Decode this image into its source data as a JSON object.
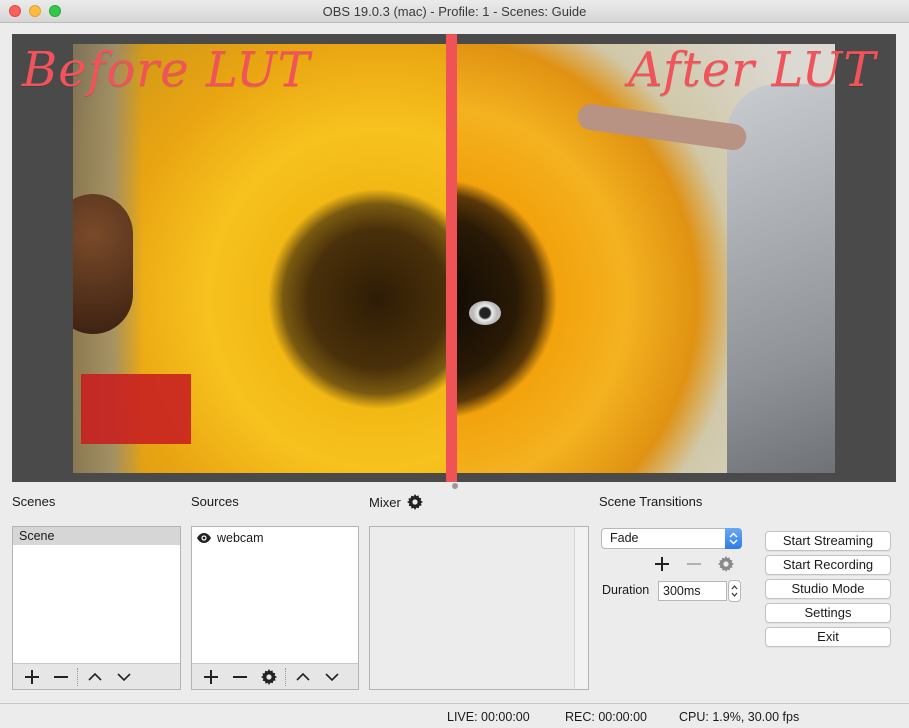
{
  "window": {
    "title": "OBS 19.0.3 (mac) - Profile: 1 - Scenes: Guide"
  },
  "preview": {
    "left_label": "Before LUT",
    "right_label": "After LUT",
    "colors": {
      "background": "#4a4a4a",
      "divider": "#ef5356",
      "label": "#f0545a"
    }
  },
  "docks": {
    "scenes_title": "Scenes",
    "sources_title": "Sources",
    "mixer_title": "Mixer",
    "transitions_title": "Scene Transitions"
  },
  "scenes": {
    "items": [
      "Scene"
    ],
    "toolbar": [
      "plus-icon",
      "minus-icon",
      "chevron-up-icon",
      "chevron-down-icon"
    ]
  },
  "sources": {
    "items": [
      {
        "label": "webcam",
        "visible": true
      }
    ],
    "toolbar": [
      "plus-icon",
      "minus-icon",
      "gear-icon",
      "chevron-up-icon",
      "chevron-down-icon"
    ]
  },
  "transitions": {
    "selected": "Fade",
    "duration_label": "Duration",
    "duration_value": "300ms"
  },
  "controls": {
    "start_streaming": "Start Streaming",
    "start_recording": "Start Recording",
    "studio_mode": "Studio Mode",
    "settings": "Settings",
    "exit": "Exit"
  },
  "status": {
    "live": "LIVE: 00:00:00",
    "rec": "REC: 00:00:00",
    "cpu": "CPU: 1.9%, 30.00 fps"
  }
}
